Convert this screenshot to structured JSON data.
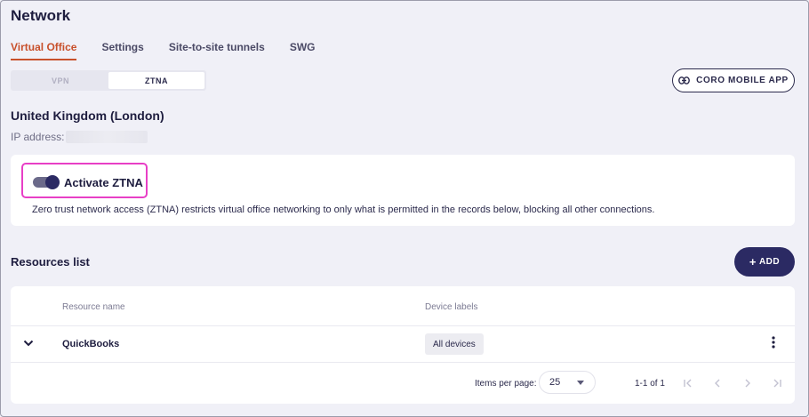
{
  "page": {
    "title": "Network"
  },
  "tabs": [
    {
      "label": "Virtual Office",
      "active": true
    },
    {
      "label": "Settings",
      "active": false
    },
    {
      "label": "Site-to-site tunnels",
      "active": false
    },
    {
      "label": "SWG",
      "active": false
    }
  ],
  "mode_toggle": {
    "options": [
      {
        "label": "VPN",
        "active": false
      },
      {
        "label": "ZTNA",
        "active": true
      }
    ]
  },
  "mobile_app_button": {
    "label": "CORO MOBILE APP",
    "icon": "link-icon"
  },
  "location": {
    "name": "United Kingdom (London)",
    "ip_label": "IP address:",
    "ip_value_redacted": true
  },
  "ztna": {
    "toggle_label": "Activate ZTNA",
    "enabled": true,
    "description": "Zero trust network access (ZTNA) restricts virtual office networking to only what is permitted in the records below, blocking all other connections."
  },
  "resources": {
    "title": "Resources list",
    "add_label": "ADD",
    "columns": [
      "Resource name",
      "Device labels"
    ],
    "rows": [
      {
        "name": "QuickBooks",
        "device_labels": "All devices"
      }
    ]
  },
  "pagination": {
    "items_per_page_label": "Items per page:",
    "items_per_page": "25",
    "range": "1-1 of 1"
  },
  "colors": {
    "accent": "#c8502b",
    "primary": "#2b2a63",
    "highlight": "#e83fc6",
    "background": "#f0f0f7"
  }
}
